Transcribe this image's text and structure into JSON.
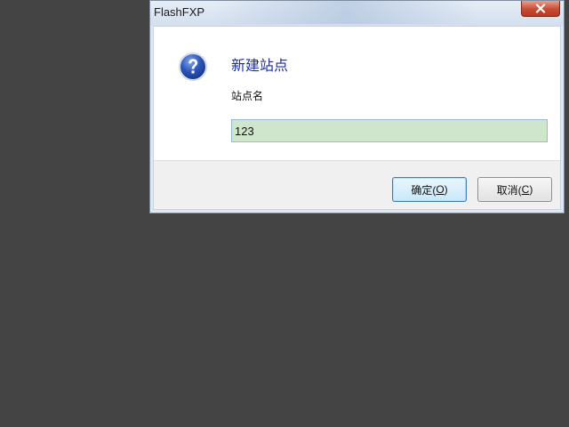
{
  "window": {
    "title": "FlashFXP"
  },
  "dialog": {
    "main_instruction": "新建站点",
    "label": "站点名",
    "input_value": "123",
    "ok_button": {
      "text": "确定(",
      "accel": "O",
      "suffix": ")"
    },
    "cancel_button": {
      "text": "取消(",
      "accel": "C",
      "suffix": ")"
    }
  },
  "icons": {
    "question": "question-icon",
    "close": "close-icon"
  },
  "colors": {
    "desktop": "#444444",
    "instruction_text": "#1c2ea0",
    "input_background": "#cfe6cd",
    "close_button": "#c74a32"
  }
}
